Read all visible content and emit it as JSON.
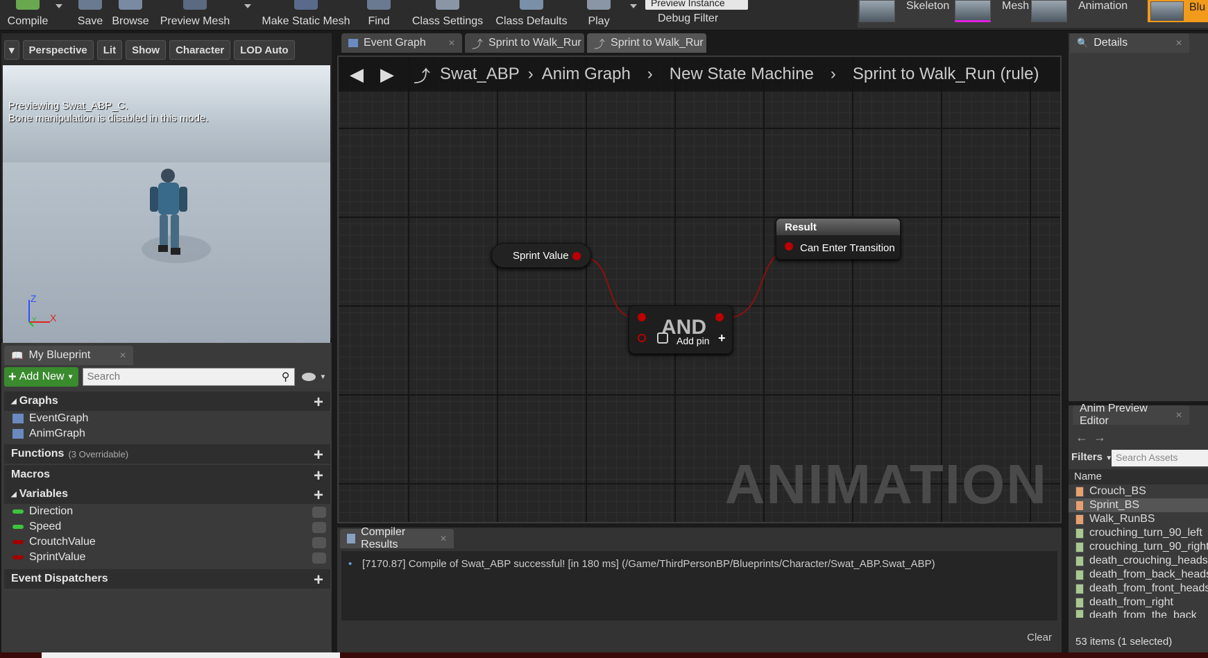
{
  "toolbar": {
    "items": [
      {
        "label": "Compile",
        "icon": "compile-check-icon"
      },
      {
        "label": "Save",
        "icon": "save-icon"
      },
      {
        "label": "Browse",
        "icon": "browse-icon"
      },
      {
        "label": "Preview Mesh",
        "icon": "preview-mesh-icon"
      },
      {
        "label": "Make Static Mesh",
        "icon": "make-static-mesh-icon"
      },
      {
        "label": "Find",
        "icon": "find-icon"
      },
      {
        "label": "Class Settings",
        "icon": "class-settings-icon"
      },
      {
        "label": "Class Defaults",
        "icon": "class-defaults-icon"
      },
      {
        "label": "Play",
        "icon": "play-icon"
      }
    ],
    "debug_select": "Preview Instance",
    "debug_label": "Debug Filter",
    "modes": [
      "Skeleton",
      "Mesh",
      "Animation",
      "Blu"
    ]
  },
  "viewport": {
    "buttons": [
      "Perspective",
      "Lit",
      "Show",
      "Character",
      "LOD Auto"
    ],
    "overlay_line1": "Previewing Swat_ABP_C.",
    "overlay_line2": "Bone manipulation is disabled in this mode.",
    "axis_z": "Z",
    "axis_x": "X",
    "axis_y": "Y"
  },
  "my_blueprint": {
    "tab": "My Blueprint",
    "add_new": "Add New",
    "search_placeholder": "Search",
    "graphs_label": "Graphs",
    "graphs": [
      "EventGraph",
      "AnimGraph"
    ],
    "functions_label": "Functions",
    "functions_note": "(3 Overridable)",
    "macros_label": "Macros",
    "variables_label": "Variables",
    "variables": [
      {
        "name": "Direction",
        "color": "#3ec43e"
      },
      {
        "name": "Speed",
        "color": "#3ec43e"
      },
      {
        "name": "CroutchValue",
        "color": "#a00000"
      },
      {
        "name": "SprintValue",
        "color": "#a00000"
      }
    ],
    "dispatchers_label": "Event Dispatchers"
  },
  "graph": {
    "tabs": [
      "Event Graph",
      "Sprint to Walk_Rur",
      "Sprint to Walk_Rur"
    ],
    "breadcrumb": [
      "Swat_ABP",
      "Anim Graph",
      "New State Machine",
      "Sprint to Walk_Run (rule)"
    ],
    "watermark": "ANIMATION",
    "node_sprint": "Sprint Value",
    "node_and": "AND",
    "node_and_addpin": "Add pin",
    "node_result_title": "Result",
    "node_result_pin": "Can Enter Transition"
  },
  "compiler": {
    "tab": "Compiler Results",
    "message": "[7170.87] Compile of Swat_ABP successful! [in 180 ms] (/Game/ThirdPersonBP/Blueprints/Character/Swat_ABP.Swat_ABP)",
    "clear": "Clear"
  },
  "details": {
    "tab": "Details"
  },
  "anim_preview": {
    "tab": "Anim Preview Editor",
    "filters": "Filters",
    "search_placeholder": "Search Assets",
    "column": "Name",
    "assets": [
      "Crouch_BS",
      "Sprint_BS",
      "Walk_RunBS",
      "crouching_turn_90_left",
      "crouching_turn_90_right",
      "death_crouching_heads",
      "death_from_back_heads",
      "death_from_front_heads",
      "death_from_right",
      "death_from_the_back"
    ],
    "selected": "Sprint_BS",
    "count": "53 items (1 selected)"
  }
}
